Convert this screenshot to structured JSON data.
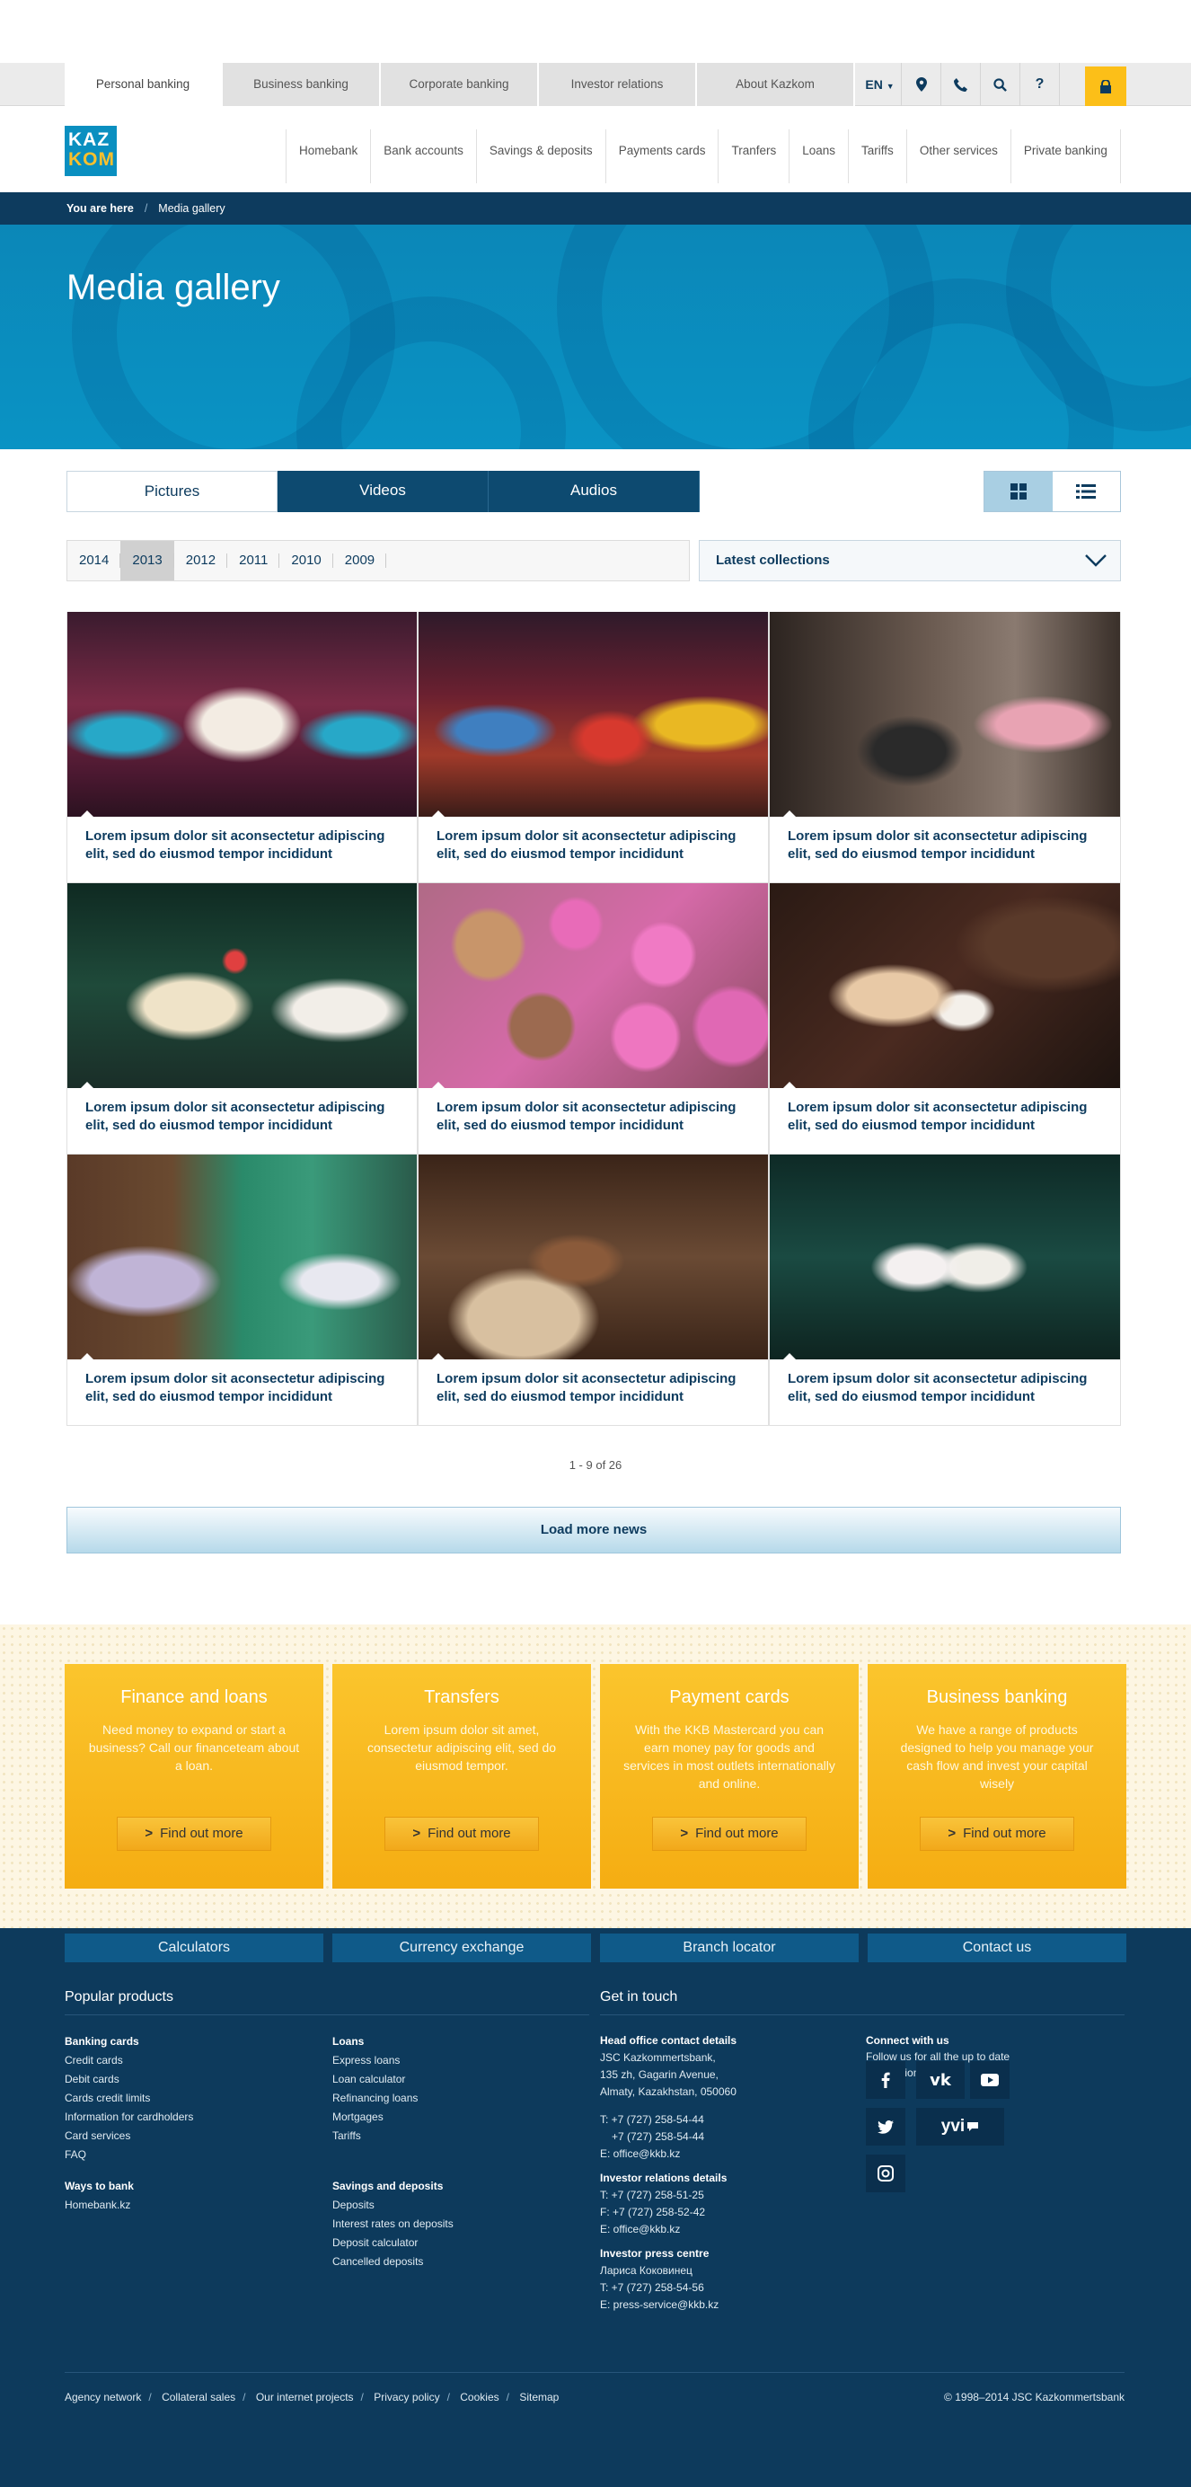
{
  "topbar": {
    "segments": [
      "Personal banking",
      "Business banking",
      "Corporate banking",
      "Investor relations",
      "About Kazkom"
    ],
    "active_segment": "Personal banking",
    "language": "EN",
    "icons": [
      "location-icon",
      "phone-icon",
      "search-icon",
      "help-icon",
      "lock-icon"
    ]
  },
  "logo": {
    "line1": "KAZ",
    "line2": "KOM"
  },
  "nav": [
    "Homebank",
    "Bank accounts",
    "Savings & deposits",
    "Payments cards",
    "Tranfers",
    "Loans",
    "Tariffs",
    "Other services",
    "Private banking"
  ],
  "breadcrumb": {
    "label": "You are here",
    "current": "Media gallery"
  },
  "hero": {
    "title": "Media gallery"
  },
  "tabs": [
    "Pictures",
    "Videos",
    "Audios"
  ],
  "years": [
    "2014",
    "2013",
    "2012",
    "2011",
    "2010",
    "2009"
  ],
  "selected_year": "2013",
  "collections_select": "Latest collections",
  "gallery": {
    "items": [
      {
        "caption": "Lorem ipsum dolor sit aconsectetur adipiscing elit, sed do eiusmod tempor incididunt"
      },
      {
        "caption": "Lorem ipsum dolor sit aconsectetur adipiscing elit, sed do eiusmod tempor incididunt"
      },
      {
        "caption": "Lorem ipsum dolor sit aconsectetur adipiscing elit, sed do eiusmod tempor incididunt"
      },
      {
        "caption": "Lorem ipsum dolor sit aconsectetur adipiscing elit, sed do eiusmod tempor incididunt"
      },
      {
        "caption": "Lorem ipsum dolor sit aconsectetur adipiscing elit, sed do eiusmod tempor incididunt"
      },
      {
        "caption": "Lorem ipsum dolor sit aconsectetur adipiscing elit, sed do eiusmod tempor incididunt"
      },
      {
        "caption": "Lorem ipsum dolor sit aconsectetur adipiscing elit, sed do eiusmod tempor incididunt"
      },
      {
        "caption": "Lorem ipsum dolor sit aconsectetur adipiscing elit, sed do eiusmod tempor incididunt"
      },
      {
        "caption": "Lorem ipsum dolor sit aconsectetur adipiscing elit, sed do eiusmod tempor incididunt"
      }
    ]
  },
  "pager": "1 - 9 of 26",
  "load_more": "Load more news",
  "promo": [
    {
      "title": "Finance and loans",
      "text": "Need money to expand or start a business? Call our financeteam about a loan.",
      "button": "Find out more"
    },
    {
      "title": "Transfers",
      "text": "Lorem ipsum dolor sit amet, consectetur adipiscing elit, sed do eiusmod tempor.",
      "button": "Find out more"
    },
    {
      "title": "Payment cards",
      "text": "With the KKB Mastercard you can earn money pay for goods and services in most outlets internationally and online.",
      "button": "Find out more"
    },
    {
      "title": "Business banking",
      "text": "We have a range of products designed to help you manage your cash flow and invest your capital wisely",
      "button": "Find out more"
    }
  ],
  "footer": {
    "quick_links": [
      "Calculators",
      "Currency exchange",
      "Branch locator",
      "Contact us"
    ],
    "popular_heading": "Popular products",
    "contact_heading": "Get in touch",
    "banking_cards": {
      "title": "Banking cards",
      "links": [
        "Credit cards",
        "Debit cards",
        "Cards credit limits",
        "Information for cardholders",
        "Card services",
        "FAQ"
      ]
    },
    "ways": {
      "title": "Ways to bank",
      "links": [
        "Homebank.kz"
      ]
    },
    "loans": {
      "title": "Loans",
      "links": [
        "Express loans",
        "Loan calculator",
        "Refinancing loans",
        "Mortgages",
        "Tariffs"
      ]
    },
    "savings": {
      "title": "Savings and deposits",
      "links": [
        "Deposits",
        "Interest rates on deposits",
        "Deposit calculator",
        "Cancelled deposits"
      ]
    },
    "head_office": {
      "title": "Head office contact details",
      "lines": [
        "JSC Kazkommertsbank,",
        "135 zh, Gagarin Avenue,",
        "Almaty, Kazakhstan, 050060"
      ],
      "phone1": "T: +7 (727) 258-54-44",
      "phone2": "+7 (727) 258-54-44",
      "email": "E: office@kkb.kz"
    },
    "investor": {
      "title": "Investor relations details",
      "phone1": "T: +7 (727) 258-51-25",
      "fax": "F: +7 (727) 258-52-42",
      "email": "E: office@kkb.kz"
    },
    "press": {
      "title": "Investor press centre",
      "name": "Лариса Коковинец",
      "phone": "T: +7 (727) 258-54-56",
      "email": "E: press-service@kkb.kz"
    },
    "connect": {
      "title": "Connect with us",
      "text": "Follow us for all the up to date information"
    },
    "social": [
      "facebook-icon",
      "vk-icon",
      "youtube-icon",
      "twitter-icon",
      "yvi-icon",
      "instagram-icon"
    ],
    "yvi_label": "yvi",
    "bottom_links": [
      "Agency network",
      "Collateral sales",
      "Our internet projects",
      "Privacy policy",
      "Cookies",
      "Sitemap"
    ],
    "copyright": "© 1998–2014 JSC Kazkommertsbank"
  }
}
